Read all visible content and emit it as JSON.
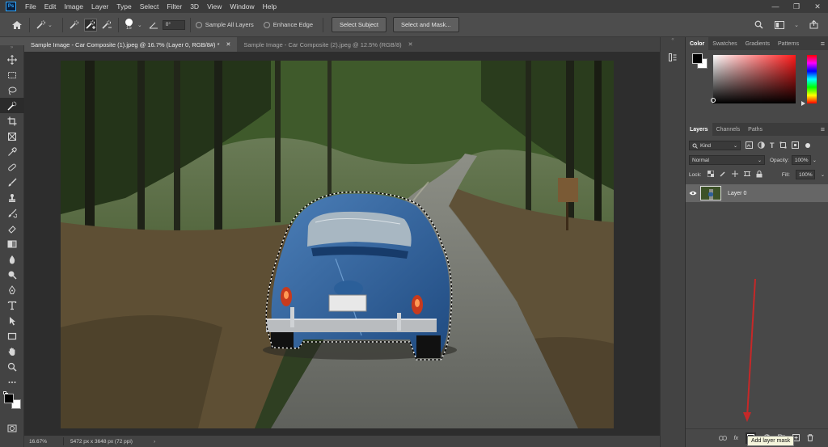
{
  "menubar": {
    "items": [
      "File",
      "Edit",
      "Image",
      "Layer",
      "Type",
      "Select",
      "Filter",
      "3D",
      "View",
      "Window",
      "Help"
    ],
    "window_controls": [
      "—",
      "❐",
      "✕"
    ]
  },
  "options": {
    "brush_size": "15",
    "angle_value": "0°",
    "sample_all_layers": "Sample All Layers",
    "enhance_edge": "Enhance Edge",
    "select_subject": "Select Subject",
    "select_and_mask": "Select and Mask..."
  },
  "tabs": [
    {
      "label": "Sample Image - Car Composite (1).jpeg @ 16.7% (Layer 0, RGB/8#) *",
      "close": "✕"
    },
    {
      "label": "Sample Image - Car Composite (2).jpeg @ 12.5% (RGB/8)",
      "close": "✕"
    }
  ],
  "status": {
    "zoom": "16.67%",
    "dimensions": "5472 px x 3648 px (72 ppi)",
    "arrow": "›"
  },
  "color_panel": {
    "tabs": [
      "Color",
      "Swatches",
      "Gradients",
      "Patterns"
    ]
  },
  "layers_panel": {
    "tabs": [
      "Layers",
      "Channels",
      "Paths"
    ],
    "filter_kind": "Kind",
    "blend_mode": "Normal",
    "opacity_label": "Opacity:",
    "opacity_value": "100%",
    "lock_label": "Lock:",
    "fill_label": "Fill:",
    "fill_value": "100%",
    "layer_name": "Layer 0",
    "tooltip": "Add layer mask",
    "footer_fx": "fx"
  },
  "colors": {
    "annotation_arrow": "#c62828",
    "foreground": "#000000",
    "background": "#ffffff"
  }
}
